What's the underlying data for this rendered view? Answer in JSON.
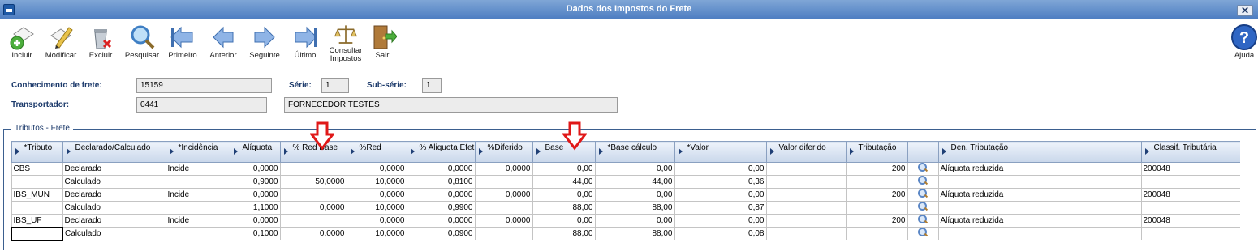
{
  "window": {
    "title": "Dados dos Impostos do Frete",
    "close_label": "✕"
  },
  "toolbar": {
    "incluir": "Incluir",
    "modificar": "Modificar",
    "excluir": "Excluir",
    "pesquisar": "Pesquisar",
    "primeiro": "Primeiro",
    "anterior": "Anterior",
    "seguinte": "Seguinte",
    "ultimo": "Último",
    "consultar_1": "Consultar",
    "consultar_2": "Impostos",
    "sair": "Sair",
    "ajuda": "Ajuda"
  },
  "form": {
    "conhecimento_label": "Conhecimento de frete:",
    "conhecimento_value": "15159",
    "serie_label": "Série:",
    "serie_value": "1",
    "subserie_label": "Sub-série:",
    "subserie_value": "1",
    "transportador_label": "Transportador:",
    "transportador_code": "0441",
    "transportador_name": "FORNECEDOR TESTES"
  },
  "group": {
    "title": "Tributos - Frete"
  },
  "table": {
    "headers": [
      "*Tributo",
      "Declarado/Calculado",
      "*Incidência",
      "Alíquota",
      "% Red Base",
      "%Red",
      "% Aliquota Efet.",
      "%Diferido",
      "Base",
      "*Base cálculo",
      "*Valor",
      "Valor diferido",
      "Tributação",
      "",
      "Den. Tributação",
      "Classif. Tributária"
    ],
    "rows": [
      [
        "CBS",
        "Declarado",
        "Incide",
        "0,0000",
        "",
        "0,0000",
        "0,0000",
        "0,0000",
        "0,00",
        "0,00",
        "0,00",
        "",
        "200",
        "",
        "Alíquota reduzida",
        "200048"
      ],
      [
        "",
        "Calculado",
        "",
        "0,9000",
        "50,0000",
        "10,0000",
        "0,8100",
        "",
        "44,00",
        "44,00",
        "0,36",
        "",
        "",
        "",
        "",
        ""
      ],
      [
        "IBS_MUN",
        "Declarado",
        "Incide",
        "0,0000",
        "",
        "0,0000",
        "0,0000",
        "0,0000",
        "0,00",
        "0,00",
        "0,00",
        "",
        "200",
        "",
        "Alíquota reduzida",
        "200048"
      ],
      [
        "",
        "Calculado",
        "",
        "1,1000",
        "0,0000",
        "10,0000",
        "0,9900",
        "",
        "88,00",
        "88,00",
        "0,87",
        "",
        "",
        "",
        "",
        ""
      ],
      [
        "IBS_UF",
        "Declarado",
        "Incide",
        "0,0000",
        "",
        "0,0000",
        "0,0000",
        "0,0000",
        "0,00",
        "0,00",
        "0,00",
        "",
        "200",
        "",
        "Alíquota reduzida",
        "200048"
      ],
      [
        "",
        "Calculado",
        "",
        "0,1000",
        "0,0000",
        "10,0000",
        "0,0900",
        "",
        "88,00",
        "88,00",
        "0,08",
        "",
        "",
        "",
        "",
        ""
      ]
    ]
  },
  "colors": {
    "accent": "#1c3a6b",
    "annotation_arrow": "#e01818"
  }
}
